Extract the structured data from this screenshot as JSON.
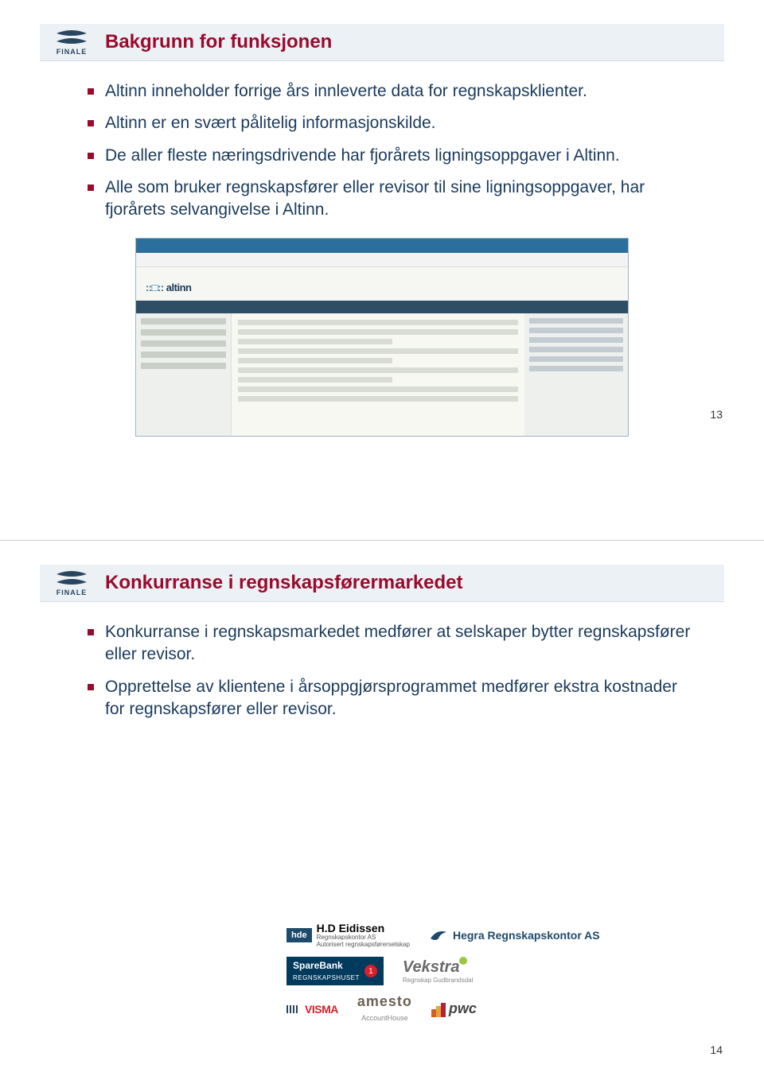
{
  "slide1": {
    "logo_text": "FINALE",
    "title": "Bakgrunn for funksjonen",
    "bullets": [
      "Altinn inneholder forrige års innleverte data for regnskapsklienter.",
      "Altinn er en svært pålitelig informasjonskilde.",
      "De aller fleste næringsdrivende har fjorårets ligningsoppgaver i Altinn.",
      "Alle som bruker regnskapsfører eller revisor til sine ligningsoppgaver, har fjorårets selvangivelse i Altinn."
    ],
    "screenshot_altinn_label": "altinn",
    "page_number": "13"
  },
  "slide2": {
    "logo_text": "FINALE",
    "title": "Konkurranse i regnskapsførermarkedet",
    "bullets": [
      "Konkurranse i regnskapsmarkedet medfører at selskaper bytter regnskapsfører eller revisor.",
      "Opprettelse av klientene i årsoppgjørsprogrammet medfører ekstra kostnader for regnskapsfører eller revisor."
    ],
    "brands": {
      "hde": "hde",
      "hde_name": "H.D Eidissen",
      "hde_sub1": "Regnskapskontor AS",
      "hde_sub2": "Autorisert regnskapsførerselskap",
      "hegra": "Hegra Regnskapskontor AS",
      "sparebank_top": "SpareBank",
      "sparebank_bottom": "REGNSKAPSHUSET",
      "sparebank_one": "1",
      "vekstra": "Vekstra",
      "vekstra_sub": "Regnskap Gudbrandsdal",
      "visma": "VISMA",
      "amesto": "amesto",
      "amesto_sub": "AccountHouse",
      "pwc": "pwc"
    },
    "page_number": "14"
  }
}
